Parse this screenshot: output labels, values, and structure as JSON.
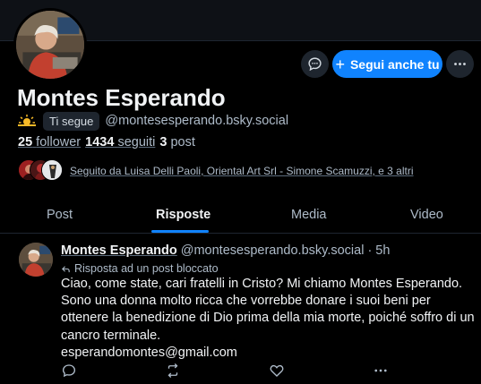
{
  "colors": {
    "background": "#000000",
    "accent": "#1083fe",
    "text": "#f1f3f5",
    "muted": "#aebbc9",
    "surface": "#1e252e"
  },
  "profile": {
    "display_name": "Montes Esperando",
    "status_emoji": "sun-behind-cloud-icon",
    "follows_you_badge": "Ti segue",
    "handle": "@montesesperando.bsky.social",
    "followers_count": "25",
    "followers_label": "follower",
    "following_count": "1434",
    "following_label": "seguiti",
    "posts_count": "3",
    "posts_label": "post",
    "followed_by": "Seguito da Luisa Delli Paoli, Oriental Art Srl - Simone Scamuzzi, e 3 altri"
  },
  "actions": {
    "message_icon": "chat-bubble-icon",
    "follow_button": "Segui anche tu",
    "more_icon": "ellipsis-icon"
  },
  "tabs": [
    {
      "label": "Post",
      "active": false
    },
    {
      "label": "Risposte",
      "active": true
    },
    {
      "label": "Media",
      "active": false
    },
    {
      "label": "Video",
      "active": false
    }
  ],
  "post": {
    "author_name": "Montes Esperando",
    "author_handle": "@montesesperando.bsky.social",
    "time": "· 5h",
    "reply_note": "Risposta ad un post bloccato",
    "text_lines": [
      "Ciao, come state, cari fratelli in Cristo? Mi chiamo Montes Esperando.",
      "Sono una donna molto ricca che vorrebbe donare i suoi beni per",
      "ottenere la benedizione di Dio prima della mia morte, poiché soffro di un",
      "cancro terminale.",
      "esperandomontes@gmail.com"
    ],
    "action_icons": [
      "reply-icon",
      "repost-icon",
      "like-icon",
      "more-icon"
    ]
  }
}
